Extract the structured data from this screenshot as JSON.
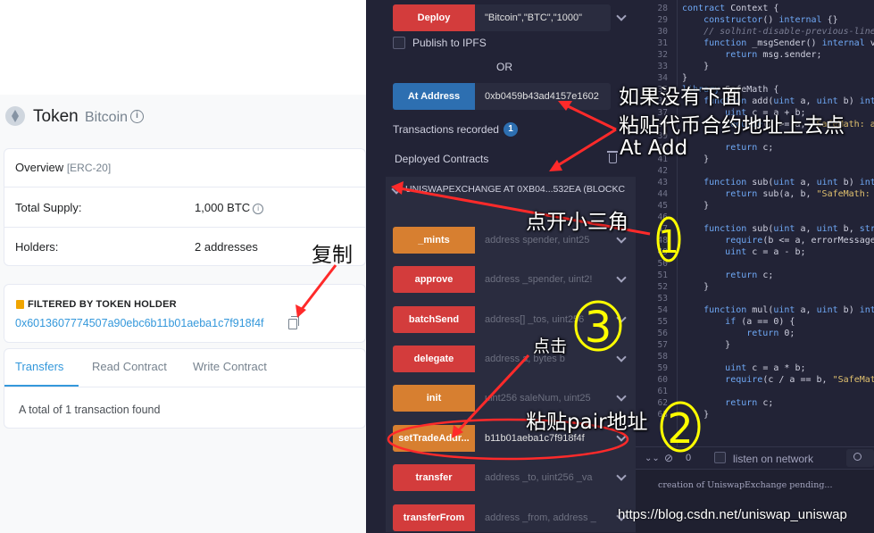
{
  "etherscan": {
    "token_label": "Token",
    "token_name": "Bitcoin",
    "overview_label": "Overview",
    "overview_tag": "[ERC-20]",
    "total_supply_label": "Total Supply:",
    "total_supply_value": "1,000 BTC",
    "holders_label": "Holders:",
    "holders_value": "2 addresses",
    "filter_label": "FILTERED BY TOKEN HOLDER",
    "filter_address": "0x6013607774507a90ebc6b11b01aeba1c7f918f4f",
    "tabs": [
      "Transfers",
      "Read Contract",
      "Write Contract"
    ],
    "tx_found": "A total of 1 transaction found"
  },
  "remix": {
    "deploy_label": "Deploy",
    "deploy_args": "\"Bitcoin\",\"BTC\",\"1000\"",
    "publish_label": "Publish to IPFS",
    "or_label": "OR",
    "at_address_label": "At Address",
    "at_address_value": "0xb0459b43ad4157e1602",
    "tx_recorded_label": "Transactions recorded",
    "tx_recorded_count": "1",
    "deployed_label": "Deployed Contracts",
    "contract_instance": "UNISWAPEXCHANGE AT 0XB04...532EA (BLOCKC",
    "functions": [
      {
        "label": "_mints",
        "placeholder": "address spender, uint25",
        "color": "orange"
      },
      {
        "label": "approve",
        "placeholder": "address _spender, uint2!",
        "color": "red"
      },
      {
        "label": "batchSend",
        "placeholder": "address[] _tos, uint256",
        "color": "red"
      },
      {
        "label": "delegate",
        "placeholder": "address a, bytes b",
        "color": "red"
      },
      {
        "label": "init",
        "placeholder": "uint256 saleNum, uint25",
        "color": "orange"
      },
      {
        "label": "setTradeAddr...",
        "value": "b11b01aeba1c7f918f4f",
        "color": "orange"
      },
      {
        "label": "transfer",
        "placeholder": "address _to, uint256 _va",
        "color": "red"
      },
      {
        "label": "transferFrom",
        "placeholder": "address _from, address _",
        "color": "red"
      }
    ]
  },
  "editor": {
    "lines": [
      {
        "n": "28",
        "html": "<span class=\"kw\">contract</span> Context {"
      },
      {
        "n": "29",
        "html": "    <span class=\"kw\">constructor</span>() <span class=\"kw\">internal</span> {}"
      },
      {
        "n": "30",
        "html": "    <span class=\"cm\">// solhint-disable-previous-line</span>"
      },
      {
        "n": "31",
        "html": "    <span class=\"kw\">function</span> _msgSender() <span class=\"kw\">internal</span> v"
      },
      {
        "n": "32",
        "html": "        <span class=\"kw\">return</span> msg.sender;"
      },
      {
        "n": "33",
        "html": "    }"
      },
      {
        "n": "34",
        "html": "}"
      },
      {
        "n": "35",
        "html": "<span class=\"kw\">library</span> SafeMath {"
      },
      {
        "n": "36",
        "html": "    <span class=\"kw\">function</span> add(<span class=\"kw\">uint</span> a, <span class=\"kw\">uint</span> b) <span class=\"kw\">int</span>"
      },
      {
        "n": "37",
        "html": "        <span class=\"kw\">uint</span> c = a + b;"
      },
      {
        "n": "38",
        "html": "        <span class=\"kw\">require</span>(c >= a, <span class=\"str\">\"SafeMath: a</span>"
      },
      {
        "n": "39",
        "html": ""
      },
      {
        "n": "40",
        "html": "        <span class=\"kw\">return</span> c;"
      },
      {
        "n": "41",
        "html": "    }"
      },
      {
        "n": "42",
        "html": ""
      },
      {
        "n": "43",
        "html": "    <span class=\"kw\">function</span> sub(<span class=\"kw\">uint</span> a, <span class=\"kw\">uint</span> b) <span class=\"kw\">int</span>"
      },
      {
        "n": "44",
        "html": "        <span class=\"kw\">return</span> sub(a, b, <span class=\"str\">\"SafeMath:</span>"
      },
      {
        "n": "45",
        "html": "    }"
      },
      {
        "n": "46",
        "html": ""
      },
      {
        "n": "47",
        "html": "    <span class=\"kw\">function</span> sub(<span class=\"kw\">uint</span> a, <span class=\"kw\">uint</span> b, <span class=\"kw\">str</span>"
      },
      {
        "n": "48",
        "html": "        <span class=\"kw\">require</span>(b <= a, errorMessage"
      },
      {
        "n": "49",
        "html": "        <span class=\"kw\">uint</span> c = a - b;"
      },
      {
        "n": "50",
        "html": ""
      },
      {
        "n": "51",
        "html": "        <span class=\"kw\">return</span> c;"
      },
      {
        "n": "52",
        "html": "    }"
      },
      {
        "n": "53",
        "html": ""
      },
      {
        "n": "54",
        "html": "    <span class=\"kw\">function</span> mul(<span class=\"kw\">uint</span> a, <span class=\"kw\">uint</span> b) <span class=\"kw\">int</span>"
      },
      {
        "n": "55",
        "html": "        <span class=\"kw\">if</span> (a == 0) {"
      },
      {
        "n": "56",
        "html": "            <span class=\"kw\">return</span> 0;"
      },
      {
        "n": "57",
        "html": "        }"
      },
      {
        "n": "58",
        "html": ""
      },
      {
        "n": "59",
        "html": "        <span class=\"kw\">uint</span> c = a * b;"
      },
      {
        "n": "60",
        "html": "        <span class=\"kw\">require</span>(c / a == b, <span class=\"str\">\"SafeMat</span>"
      },
      {
        "n": "61",
        "html": ""
      },
      {
        "n": "62",
        "html": "        <span class=\"kw\">return</span> c;"
      },
      {
        "n": "63",
        "html": "    }"
      }
    ]
  },
  "terminal": {
    "count": "0",
    "listen_label": "listen on network",
    "log": "creation of UniswapExchange pending..."
  },
  "annotations": {
    "copy": "复制",
    "paste_line1": "如果没有下面",
    "paste_line2": "粘贴代币合约地址上去点",
    "paste_line3": "At Add",
    "open_triangle": "点开小三角",
    "click": "点击",
    "paste_pair": "粘贴pair地址",
    "circle_1": "1",
    "circle_2": "2",
    "circle_3": "3"
  },
  "watermark": "https://blog.csdn.net/uniswap_uniswap",
  "colors": {
    "red_button": "#d33c3c",
    "orange_button": "#d77f30",
    "blue_button": "#2d6fb1",
    "annotation_red": "#ff2a2a",
    "annotation_yellow": "#ffff00",
    "link": "#3498db"
  }
}
